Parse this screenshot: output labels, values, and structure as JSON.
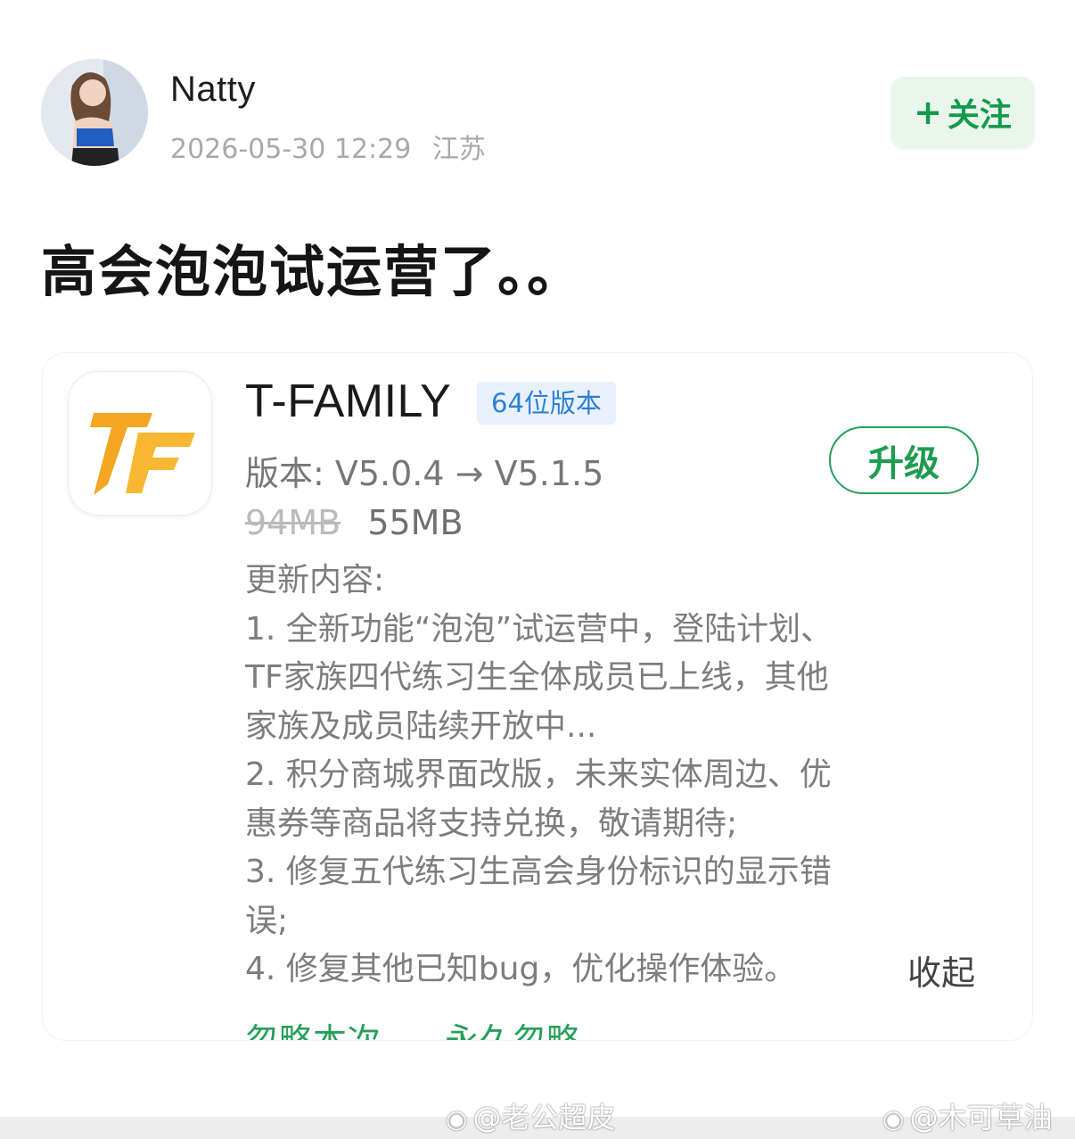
{
  "post": {
    "author": "Natty",
    "datetime": "2026-05-30 12:29",
    "location": "江苏",
    "follow_label": "关注",
    "follow_plus": "+",
    "text": "高会泡泡试运营了。。"
  },
  "update_card": {
    "app_name": "T-FAMILY",
    "badge": "64位版本",
    "version": "版本: V5.0.4 → V5.1.5",
    "size_old": "94MB",
    "size_new": "55MB",
    "upgrade_label": "升级",
    "changes_title": "更新内容:",
    "change_lines": [
      "1. 全新功能“泡泡”试运营中，登陆计划、",
      "TF家族四代练习生全体成员已上线，其他",
      "家族及成员陆续开放中...",
      "2. 积分商城界面改版，未来实体周边、优",
      "惠券等商品将支持兑换，敬请期待;",
      "3. 修复五代练习生高会身份标识的显示错",
      "误;",
      "4. 修复其他已知bug，优化操作体验。"
    ],
    "collapse_label": "收起",
    "ignore_once": "忽略本次",
    "ignore_forever": "永久忽略",
    "accent_color": "#25a05a",
    "icon_color": "#f5a623"
  },
  "watermarks": {
    "left": "@老公超皮",
    "right": "@木可草油"
  }
}
